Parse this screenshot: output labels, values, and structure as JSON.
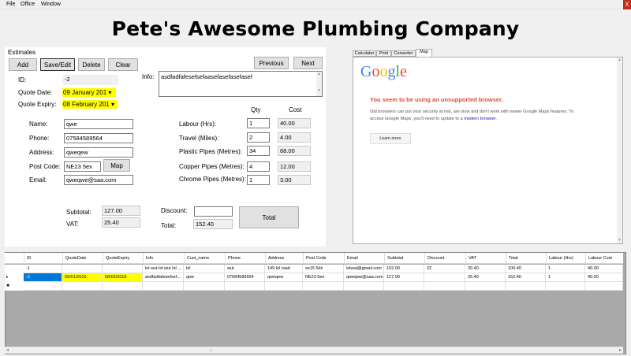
{
  "menu": {
    "file": "File",
    "office": "Office",
    "window": "Window",
    "close": "X"
  },
  "title": "Pete's Awesome Plumbing Company",
  "estimates": {
    "group_label": "Estimates",
    "buttons": {
      "add": "Add",
      "save_edit": "Save/Edit",
      "delete": "Delete",
      "clear": "Clear",
      "previous": "Previous",
      "next": "Next"
    },
    "id_label": "ID:",
    "id_value": "-2",
    "quote_date_label": "Quote Date:",
    "quote_date_value": "09   January   201",
    "quote_expiry_label": "Quote Expiry:",
    "quote_expiry_value": "08  February  201",
    "info_label": "Info:",
    "info_value": "asdfadfafesefsefaasefasefasefasef",
    "name_label": "Name:",
    "name_value": "qwe",
    "phone_label": "Phone:",
    "phone_value": "07584589564",
    "address_label": "Address:",
    "address_value": "qweqew",
    "postcode_label": "Post Code:",
    "postcode_value": "NE23 5ex",
    "map_button": "Map",
    "email_label": "Email:",
    "email_value": "qweqwe@saa.com",
    "qty_header": "Qty",
    "cost_header": "Cost",
    "items": [
      {
        "label": "Labour (Hrs):",
        "qty": "1",
        "cost": "40.00"
      },
      {
        "label": "Travel (Miles):",
        "qty": "2",
        "cost": "4.00"
      },
      {
        "label": "Plastic Pipes (Metres):",
        "qty": "34",
        "cost": "68.00"
      },
      {
        "label": "Copper Pipes (Metres):",
        "qty": "4",
        "cost": "12.00"
      },
      {
        "label": "Chrome Pipes (Metres):",
        "qty": "1",
        "cost": "3.00"
      }
    ],
    "subtotal_label": "Subtotal:",
    "subtotal_value": "127.00",
    "vat_label": "VAT:",
    "vat_value": "25.40",
    "discount_label": "Discount:",
    "discount_value": "",
    "total_label": "Total:",
    "total_value": "152.40",
    "total_button": "Total"
  },
  "tabs": [
    "Calculator",
    "Print",
    "Converter",
    "Map"
  ],
  "map": {
    "logo": "Google",
    "heading": "You seem to be using an unsupported browser.",
    "body": "Old browsers can put your security at risk, are slow and don't work with newer Google Maps features. To access Google Maps, you'll need to update to a ",
    "link": "modern browser",
    "body_end": ".",
    "learn_more": "Learn more"
  },
  "colors": {
    "yellow": "#ffff00",
    "google_blue": "#4285f4",
    "google_red": "#ea4335",
    "google_yellow": "#fbbc05",
    "google_green": "#34a853",
    "warning_red": "#dd4b39",
    "selected_row": "#0078d7"
  },
  "grid": {
    "columns": [
      "ID",
      "QuoteDate",
      "QuoteExpiry",
      "Info",
      "Cust_name",
      "Phone",
      "Address",
      "Post Code",
      "Email",
      "Subtotal",
      "Discount",
      "VAT",
      "Total",
      "Labour (Hrs)",
      "Labour Cost"
    ],
    "rows": [
      {
        "indicator": "",
        "cells": [
          "-1",
          "",
          "",
          "lol wut lol wut lol ...",
          "lol",
          "wut",
          "149 lol road",
          "se15 5dz",
          "lolwut@gmail.com",
          "102.00",
          "22",
          "20.40",
          "100.40",
          "1",
          "40.00"
        ]
      },
      {
        "indicator": "▸",
        "cells": [
          "-2",
          "09/01/2016",
          "08/02/2016",
          "asdfadfafesefsef...",
          "qwe",
          "07584589564",
          "qweqew",
          "NE23 5ex",
          "qweqwe@saa.com",
          "127.00",
          "",
          "25.40",
          "152.40",
          "1",
          "40.00"
        ]
      },
      {
        "indicator": "✱",
        "cells": [
          "",
          "",
          "",
          "",
          "",
          "",
          "",
          "",
          "",
          "",
          "",
          "",
          "",
          "",
          ""
        ]
      }
    ],
    "scroll_left": "◂",
    "scroll_right": "▸",
    "scroll_thumb": "III"
  }
}
